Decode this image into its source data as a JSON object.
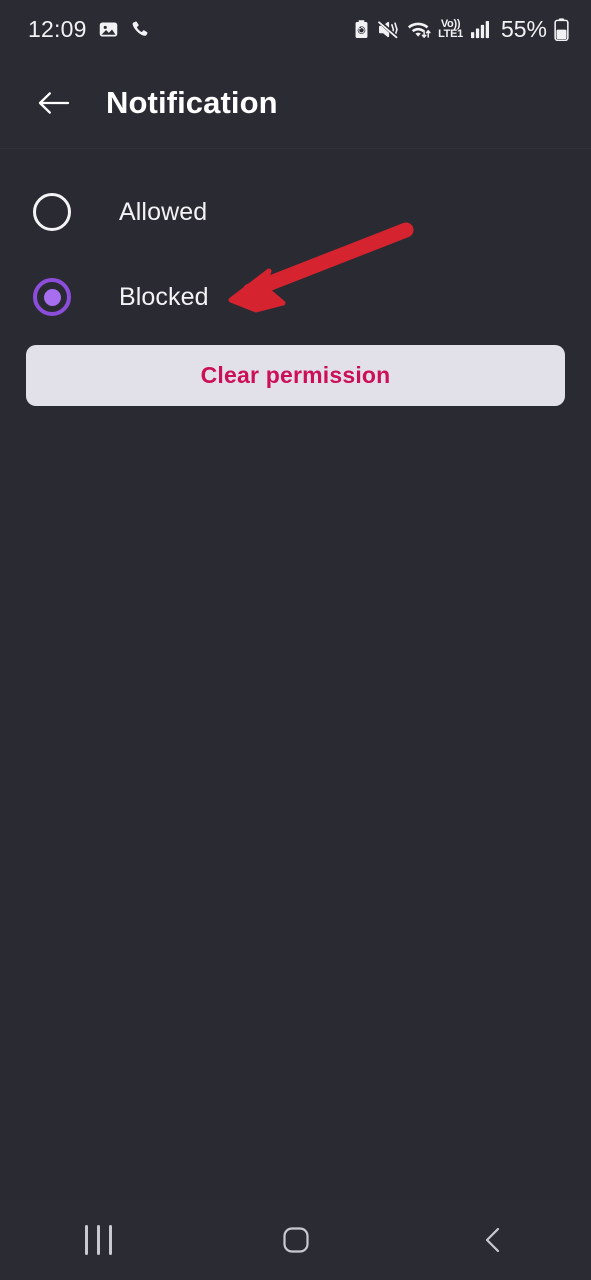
{
  "status_bar": {
    "time": "12:09",
    "battery_percent": "55%",
    "left_icons": [
      "photo-icon",
      "phone-call-icon"
    ],
    "right_icons": [
      "battery-saver-icon",
      "mute-vibrate-icon",
      "wifi-data-icon",
      "volte1-icon",
      "signal-bars-icon",
      "battery-icon"
    ],
    "volte_label_top": "Vo))",
    "volte_label_bottom": "LTE1",
    "background_color": "#2b2b34",
    "text_color": "#f2f2f5"
  },
  "app_bar": {
    "title": "Notification",
    "back_icon": "arrow-left-icon",
    "background_color": "#2b2b34",
    "title_color": "#ffffff"
  },
  "content": {
    "background_color": "#2a2a33",
    "options": [
      {
        "label": "Allowed",
        "selected": false,
        "name": "allowed"
      },
      {
        "label": "Blocked",
        "selected": true,
        "name": "blocked"
      }
    ],
    "selected_option": "Blocked",
    "accent_color": "#8d4ddb",
    "accent_inner_color": "#a86ef0",
    "clear_button": {
      "label": "Clear permission",
      "background_color": "#e2e1e9",
      "text_color": "#cc1055"
    }
  },
  "annotation": {
    "type": "arrow",
    "color": "#d5232f",
    "points_from": "408,231",
    "points_to": "233,300",
    "target": "Blocked"
  },
  "nav_bar": {
    "background_color": "#2b2b34",
    "buttons": [
      {
        "name": "recents",
        "icon": "recents-bars-icon"
      },
      {
        "name": "home",
        "icon": "home-square-icon"
      },
      {
        "name": "back",
        "icon": "chevron-left-icon"
      }
    ]
  }
}
